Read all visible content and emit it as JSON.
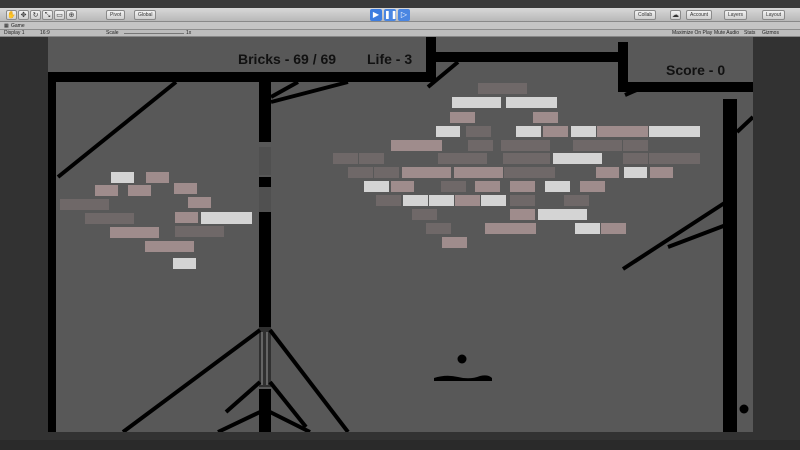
{
  "editor": {
    "tools": [
      "hand-icon",
      "move-icon",
      "rotate-icon",
      "scale-icon",
      "rect-tool-icon",
      "transform-icon"
    ],
    "pivot_label": "Pivot",
    "global_label": "Global",
    "collab_label": "Collab",
    "account_label": "Account",
    "layers_label": "Layers",
    "layout_label": "Layout",
    "tab_label": "Game",
    "display_label": "Display 1",
    "aspect_label": "16:9",
    "scale_label": "Scale",
    "scale_value": "1x",
    "maximize_label": "Maximize On Play",
    "mute_label": "Mute Audio",
    "stats_label": "Stats",
    "gizmos_label": "Gizmos"
  },
  "hud": {
    "bricks": "Bricks - 69 / 69",
    "life": "Life - 3",
    "score": "Score - 0"
  },
  "colors": {
    "background": "#585858",
    "walls": "#000000",
    "brick_white": "#d4d4d4",
    "brick_pink": "#9f8c8c",
    "brick_dark": "#6f6868",
    "play_blue": "#3d7de0"
  }
}
